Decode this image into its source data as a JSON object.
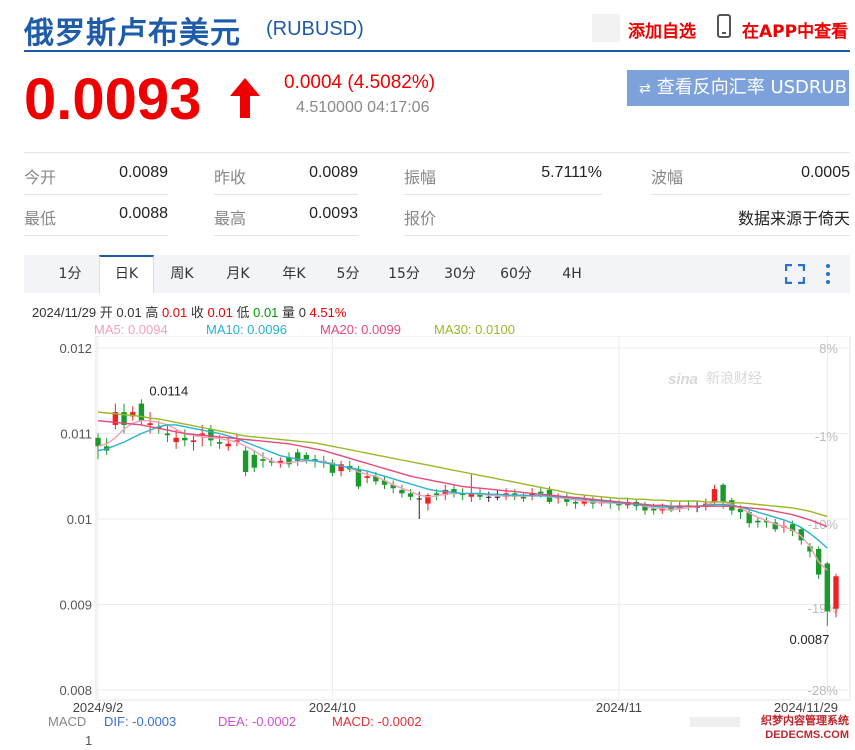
{
  "header": {
    "title": "俄罗斯卢布美元",
    "code": "(RUBUSD)",
    "add_watch": "添加自选",
    "view_app": "在APP中查看"
  },
  "quote": {
    "price": "0.0093",
    "change": "0.0004 (4.5082%)",
    "sub": "4.510000 04:17:06",
    "reverse_button": "查看反向汇率 USDRUB",
    "up_color": "#ee0000"
  },
  "stats": [
    {
      "label": "今开",
      "value": "0.0089"
    },
    {
      "label": "昨收",
      "value": "0.0089"
    },
    {
      "label": "振幅",
      "value": "5.7111%"
    },
    {
      "label": "波幅",
      "value": "0.0005"
    },
    {
      "label": "最低",
      "value": "0.0088"
    },
    {
      "label": "最高",
      "value": "0.0093"
    },
    {
      "label": "报价",
      "value": ""
    },
    {
      "label": "",
      "value": "数据来源于倚天"
    }
  ],
  "tabs": [
    "1分",
    "日K",
    "周K",
    "月K",
    "年K",
    "5分",
    "15分",
    "30分",
    "60分",
    "4H"
  ],
  "active_tab": "日K",
  "info": {
    "date": "2024/11/29",
    "open_label": "开",
    "open": "0.01",
    "high_label": "高",
    "high": "0.01",
    "close_label": "收",
    "close": "0.01",
    "low_label": "低",
    "low": "0.01",
    "vol_label": "量",
    "vol": "0",
    "pct": "4.51%"
  },
  "ma": [
    {
      "text": "MA5: 0.0094",
      "color": "#f2a0b8"
    },
    {
      "text": "MA10: 0.0096",
      "color": "#27b2d0"
    },
    {
      "text": "MA20: 0.0099",
      "color": "#e54a7a"
    },
    {
      "text": "MA30: 0.0100",
      "color": "#99b828"
    }
  ],
  "macd": {
    "label": "MACD",
    "dif": "DIF: -0.0003",
    "dea": "DEA: -0.0002",
    "macd": "MACD: -0.0002",
    "axis_value": "1"
  },
  "watermark": "新浪财经",
  "footer_watermark": "织梦内容管理系统\nDEDECMS.COM",
  "chart_data": {
    "type": "candlestick",
    "y_ticks": [
      "0.012",
      "0.011",
      "0.01",
      "0.009",
      "0.008"
    ],
    "y_tick_values": [
      0.012,
      0.011,
      0.01,
      0.009,
      0.008
    ],
    "pct_ticks": [
      "8%",
      "-1%",
      "-10%",
      "-19%",
      "-28%"
    ],
    "x_ticks": [
      "2024/9/2",
      "2024/10",
      "2024/11",
      "2024/11/29"
    ],
    "ylim": [
      0.008,
      0.012
    ],
    "max_label": "0.0114",
    "min_label": "0.0087",
    "up_color": "#ee2222",
    "down_color": "#1a9a2a",
    "candles": [
      [
        0.01095,
        0.01085,
        0.011,
        0.0107
      ],
      [
        0.01085,
        0.0108,
        0.01095,
        0.01075
      ],
      [
        0.0111,
        0.01125,
        0.01135,
        0.01105
      ],
      [
        0.01125,
        0.0111,
        0.01135,
        0.011
      ],
      [
        0.0112,
        0.01125,
        0.01132,
        0.01115
      ],
      [
        0.01135,
        0.01115,
        0.0114,
        0.0111
      ],
      [
        0.0111,
        0.01112,
        0.01125,
        0.011
      ],
      [
        0.01108,
        0.01106,
        0.01115,
        0.011
      ],
      [
        0.011,
        0.01098,
        0.0111,
        0.0109
      ],
      [
        0.0109,
        0.01095,
        0.01105,
        0.01082
      ],
      [
        0.01095,
        0.01092,
        0.01105,
        0.01085
      ],
      [
        0.0109,
        0.01092,
        0.011,
        0.0108
      ],
      [
        0.01098,
        0.011,
        0.0111,
        0.01085
      ],
      [
        0.01105,
        0.01092,
        0.0111,
        0.01085
      ],
      [
        0.0109,
        0.01088,
        0.01098,
        0.01082
      ],
      [
        0.01085,
        0.01088,
        0.01095,
        0.0108
      ],
      [
        0.0109,
        0.01092,
        0.011,
        0.01085
      ],
      [
        0.0108,
        0.01055,
        0.01085,
        0.0105
      ],
      [
        0.01075,
        0.0106,
        0.0108,
        0.01055
      ],
      [
        0.0107,
        0.01068,
        0.01078,
        0.0106
      ],
      [
        0.01068,
        0.01066,
        0.01072,
        0.01062
      ],
      [
        0.01065,
        0.01068,
        0.01072,
        0.0106
      ],
      [
        0.01072,
        0.01064,
        0.01078,
        0.0106
      ],
      [
        0.01078,
        0.01068,
        0.01082,
        0.01062
      ],
      [
        0.01075,
        0.0107,
        0.01078,
        0.01065
      ],
      [
        0.0107,
        0.01068,
        0.01075,
        0.0106
      ],
      [
        0.01068,
        0.01066,
        0.01074,
        0.0106
      ],
      [
        0.01066,
        0.01054,
        0.0107,
        0.0105
      ],
      [
        0.01056,
        0.01064,
        0.01068,
        0.0105
      ],
      [
        0.01062,
        0.01058,
        0.01068,
        0.01055
      ],
      [
        0.01058,
        0.01038,
        0.01062,
        0.01035
      ],
      [
        0.01048,
        0.0105,
        0.01055,
        0.01042
      ],
      [
        0.0105,
        0.01044,
        0.01055,
        0.0104
      ],
      [
        0.01045,
        0.0104,
        0.0105,
        0.01035
      ],
      [
        0.0104,
        0.01036,
        0.01045,
        0.0103
      ],
      [
        0.01034,
        0.0103,
        0.0104,
        0.01025
      ],
      [
        0.0103,
        0.01026,
        0.01035,
        0.01022
      ],
      [
        0.01024,
        0.01024,
        0.01032,
        0.01
      ],
      [
        0.01018,
        0.01028,
        0.0103,
        0.0101
      ],
      [
        0.0103,
        0.01028,
        0.01035,
        0.01022
      ],
      [
        0.01028,
        0.01034,
        0.0104,
        0.01022
      ],
      [
        0.01035,
        0.0103,
        0.0104,
        0.01025
      ],
      [
        0.0103,
        0.01028,
        0.01036,
        0.01022
      ],
      [
        0.01026,
        0.0103,
        0.01052,
        0.0102
      ],
      [
        0.0103,
        0.01026,
        0.01035,
        0.01022
      ],
      [
        0.01026,
        0.01026,
        0.01032,
        0.0102
      ],
      [
        0.01026,
        0.01026,
        0.01034,
        0.01022
      ],
      [
        0.01026,
        0.0103,
        0.01036,
        0.01022
      ],
      [
        0.0103,
        0.01026,
        0.01035,
        0.01022
      ],
      [
        0.01026,
        0.01024,
        0.0103,
        0.0102
      ],
      [
        0.01028,
        0.0103,
        0.01036,
        0.01022
      ],
      [
        0.01032,
        0.0103,
        0.01038,
        0.01025
      ],
      [
        0.01034,
        0.0102,
        0.01038,
        0.01018
      ],
      [
        0.01024,
        0.01026,
        0.0103,
        0.01018
      ],
      [
        0.01026,
        0.0102,
        0.0103,
        0.01015
      ],
      [
        0.0102,
        0.01018,
        0.01025,
        0.01012
      ],
      [
        0.01018,
        0.01022,
        0.01028,
        0.01015
      ],
      [
        0.01022,
        0.01018,
        0.01026,
        0.01012
      ],
      [
        0.01018,
        0.0102,
        0.01025,
        0.01015
      ],
      [
        0.0102,
        0.01018,
        0.01024,
        0.01012
      ],
      [
        0.01018,
        0.01016,
        0.01022,
        0.0101
      ],
      [
        0.01016,
        0.0102,
        0.01025,
        0.01012
      ],
      [
        0.0102,
        0.01015,
        0.01024,
        0.0101
      ],
      [
        0.01016,
        0.0101,
        0.0102,
        0.01005
      ],
      [
        0.01012,
        0.0101,
        0.01018,
        0.01005
      ],
      [
        0.0101,
        0.01012,
        0.01018,
        0.01006
      ],
      [
        0.01014,
        0.0101,
        0.0102,
        0.01008
      ],
      [
        0.01012,
        0.01016,
        0.0102,
        0.01008
      ],
      [
        0.01016,
        0.01014,
        0.01022,
        0.0101
      ],
      [
        0.01014,
        0.01014,
        0.0102,
        0.01008
      ],
      [
        0.01014,
        0.01018,
        0.01024,
        0.0101
      ],
      [
        0.0102,
        0.01035,
        0.0104,
        0.01015
      ],
      [
        0.0104,
        0.0102,
        0.01042,
        0.01012
      ],
      [
        0.01022,
        0.0101,
        0.01025,
        0.01005
      ],
      [
        0.01012,
        0.01008,
        0.01016,
        0.01
      ],
      [
        0.01008,
        0.00995,
        0.0101,
        0.0099
      ],
      [
        0.00998,
        0.00996,
        0.01002,
        0.0099
      ],
      [
        0.00998,
        0.00996,
        0.01002,
        0.0099
      ],
      [
        0.00996,
        0.00988,
        0.01,
        0.00985
      ],
      [
        0.0099,
        0.00992,
        0.00998,
        0.00984
      ],
      [
        0.00994,
        0.00986,
        0.00998,
        0.0098
      ],
      [
        0.00988,
        0.00975,
        0.0099,
        0.0097
      ],
      [
        0.00968,
        0.00962,
        0.00972,
        0.00955
      ],
      [
        0.00965,
        0.00935,
        0.00968,
        0.0093
      ],
      [
        0.00948,
        0.00892,
        0.0095,
        0.00875
      ],
      [
        0.00895,
        0.00933,
        0.00936,
        0.00885
      ]
    ],
    "ma_lines": {
      "MA5": [
        0.01085,
        0.01088,
        0.01095,
        0.01105,
        0.01112,
        0.01115,
        0.01115,
        0.01113,
        0.0111,
        0.01105,
        0.011,
        0.01098,
        0.01096,
        0.01095,
        0.01094,
        0.01092,
        0.0109,
        0.01085,
        0.0108,
        0.01073,
        0.01068,
        0.01065,
        0.01066,
        0.01067,
        0.01068,
        0.01068,
        0.01067,
        0.01065,
        0.01062,
        0.0106,
        0.01055,
        0.01052,
        0.0105,
        0.01045,
        0.0104,
        0.01036,
        0.01032,
        0.01028,
        0.01026,
        0.01027,
        0.01029,
        0.0103,
        0.0103,
        0.0103,
        0.01029,
        0.01028,
        0.01027,
        0.01027,
        0.01027,
        0.01027,
        0.01027,
        0.01028,
        0.01026,
        0.01025,
        0.01024,
        0.01022,
        0.01021,
        0.0102,
        0.01019,
        0.01019,
        0.01018,
        0.01018,
        0.01017,
        0.01015,
        0.01013,
        0.01012,
        0.01011,
        0.01012,
        0.01013,
        0.01014,
        0.01016,
        0.0102,
        0.0102,
        0.01017,
        0.01013,
        0.01007,
        0.01002,
        0.00998,
        0.00994,
        0.00991,
        0.00987,
        0.0098,
        0.00968,
        0.0095,
        0.0094
      ],
      "MA10": [
        0.0108,
        0.01082,
        0.01086,
        0.0109,
        0.01095,
        0.011,
        0.01104,
        0.01108,
        0.0111,
        0.0111,
        0.01108,
        0.01106,
        0.01104,
        0.01102,
        0.011,
        0.01097,
        0.01094,
        0.0109,
        0.01086,
        0.01082,
        0.01078,
        0.01074,
        0.01072,
        0.0107,
        0.01069,
        0.01068,
        0.01066,
        0.01064,
        0.01062,
        0.0106,
        0.01058,
        0.01056,
        0.01053,
        0.0105,
        0.01047,
        0.01044,
        0.01041,
        0.01038,
        0.01035,
        0.01033,
        0.01032,
        0.01031,
        0.0103,
        0.0103,
        0.0103,
        0.01029,
        0.01029,
        0.01028,
        0.01028,
        0.01028,
        0.01027,
        0.01027,
        0.01027,
        0.01026,
        0.01025,
        0.01024,
        0.01023,
        0.01022,
        0.01021,
        0.0102,
        0.01019,
        0.01018,
        0.01017,
        0.01016,
        0.01015,
        0.01014,
        0.01014,
        0.01014,
        0.01015,
        0.01015,
        0.01016,
        0.01017,
        0.01017,
        0.01016,
        0.01014,
        0.01011,
        0.01008,
        0.01005,
        0.01002,
        0.00999,
        0.00995,
        0.0099,
        0.00983,
        0.00975,
        0.00966
      ],
      "MA20": [
        0.01115,
        0.01114,
        0.01113,
        0.01112,
        0.01111,
        0.0111,
        0.01108,
        0.01106,
        0.01104,
        0.01102,
        0.011,
        0.01099,
        0.01098,
        0.01097,
        0.01096,
        0.01095,
        0.01094,
        0.01093,
        0.01092,
        0.01091,
        0.0109,
        0.01089,
        0.01088,
        0.01086,
        0.01084,
        0.01082,
        0.0108,
        0.01077,
        0.01074,
        0.01071,
        0.01068,
        0.01065,
        0.01062,
        0.01059,
        0.01056,
        0.01053,
        0.0105,
        0.01048,
        0.01046,
        0.01044,
        0.01042,
        0.0104,
        0.01038,
        0.01037,
        0.01036,
        0.01035,
        0.01034,
        0.01033,
        0.01032,
        0.01031,
        0.0103,
        0.01029,
        0.01028,
        0.01027,
        0.01026,
        0.01025,
        0.01024,
        0.01023,
        0.01022,
        0.01021,
        0.0102,
        0.01019,
        0.01018,
        0.01017,
        0.01016,
        0.01016,
        0.01015,
        0.01015,
        0.01015,
        0.01015,
        0.01015,
        0.01015,
        0.01015,
        0.01015,
        0.01014,
        0.01013,
        0.01012,
        0.01011,
        0.01009,
        0.01007,
        0.01005,
        0.01002,
        0.00999,
        0.00995,
        0.00991
      ],
      "MA30": [
        0.01125,
        0.01124,
        0.01123,
        0.01122,
        0.01121,
        0.0112,
        0.01118,
        0.01117,
        0.01115,
        0.01113,
        0.01111,
        0.01109,
        0.01107,
        0.01105,
        0.01103,
        0.01101,
        0.01099,
        0.01097,
        0.01096,
        0.01095,
        0.01094,
        0.01093,
        0.01092,
        0.01091,
        0.0109,
        0.01089,
        0.01087,
        0.01085,
        0.01083,
        0.01081,
        0.01079,
        0.01077,
        0.01075,
        0.01073,
        0.01071,
        0.01069,
        0.01067,
        0.01065,
        0.01063,
        0.01061,
        0.01059,
        0.01057,
        0.01055,
        0.01053,
        0.01051,
        0.01049,
        0.01047,
        0.01045,
        0.01043,
        0.01041,
        0.01039,
        0.01037,
        0.01035,
        0.01033,
        0.01031,
        0.01029,
        0.01028,
        0.01027,
        0.01026,
        0.01025,
        0.01024,
        0.01024,
        0.01023,
        0.01023,
        0.01022,
        0.01022,
        0.01021,
        0.01021,
        0.01021,
        0.01021,
        0.0102,
        0.0102,
        0.0102,
        0.01019,
        0.01019,
        0.01018,
        0.01017,
        0.01016,
        0.01015,
        0.01014,
        0.01013,
        0.01011,
        0.01009,
        0.01006,
        0.01003
      ]
    }
  }
}
